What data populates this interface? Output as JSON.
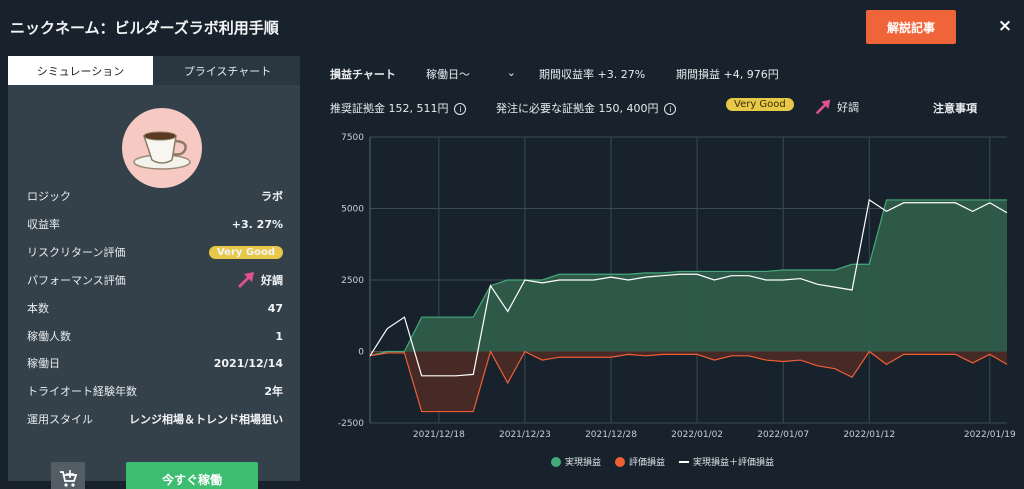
{
  "header": {
    "title": "ニックネーム：ビルダーズラボ利用手順",
    "article_button": "解説記事",
    "close_label": "×"
  },
  "left_panel": {
    "tabs": [
      "シミュレーション",
      "プライスチャート"
    ],
    "avatar_icon": "coffee-cup-icon",
    "rows": [
      {
        "label": "ロジック",
        "value": "ラボ"
      },
      {
        "label": "収益率",
        "value": "+3. 27%"
      },
      {
        "label": "リスクリターン評価",
        "value": "Very Good"
      },
      {
        "label": "パフォーマンス評価",
        "value": "好調"
      },
      {
        "label": "本数",
        "value": "47"
      },
      {
        "label": "稼働人数",
        "value": "1"
      },
      {
        "label": "稼働日",
        "value": "2021/12/14"
      },
      {
        "label": "トライオート経験年数",
        "value": "2年"
      },
      {
        "label": "運用スタイル",
        "value": "レンジ相場＆トレンド相場狙い"
      }
    ],
    "start_button": "今すぐ稼働",
    "cart_icon": "cart-add-icon"
  },
  "chart_header": {
    "chart_label": "損益チャート",
    "period_select": "稼働日～",
    "period_return": "期間収益率 +3. 27%",
    "period_pnl": "期間損益 +4, 976円",
    "recommended_margin": "推奨証拠金 152, 511円",
    "required_margin": "発注に必要な証拠金 150, 400円",
    "rating": "Very Good",
    "performance": "好調",
    "notes": "注意事項"
  },
  "colors": {
    "realized": "#45a879",
    "unrealized": "#ee5f36",
    "total": "#ffffff",
    "accent_orange": "#f0643a",
    "green_button": "#3dbd6f",
    "badge_yellow": "#e7c848"
  },
  "chart_data": {
    "type": "area",
    "x": [
      "2021/12/14",
      "2021/12/15",
      "2021/12/16",
      "2021/12/17",
      "2021/12/18",
      "2021/12/19",
      "2021/12/20",
      "2021/12/21",
      "2021/12/22",
      "2021/12/23",
      "2021/12/24",
      "2021/12/25",
      "2021/12/26",
      "2021/12/27",
      "2021/12/28",
      "2021/12/29",
      "2021/12/30",
      "2021/12/31",
      "2022/01/01",
      "2022/01/02",
      "2022/01/03",
      "2022/01/04",
      "2022/01/05",
      "2022/01/06",
      "2022/01/07",
      "2022/01/08",
      "2022/01/09",
      "2022/01/10",
      "2022/01/11",
      "2022/01/12",
      "2022/01/13",
      "2022/01/14",
      "2022/01/15",
      "2022/01/16",
      "2022/01/17",
      "2022/01/18",
      "2022/01/19",
      "2022/01/20"
    ],
    "xticks": [
      "2021/12/18",
      "2021/12/23",
      "2021/12/28",
      "2022/01/02",
      "2022/01/07",
      "2022/01/12",
      "2022/01/19"
    ],
    "yticks": [
      7500,
      5000,
      2500,
      0,
      -2500
    ],
    "ylim": [
      -2500,
      7500
    ],
    "series": [
      {
        "name": "実現損益",
        "values": [
          -150,
          0,
          0,
          1200,
          1200,
          1200,
          1200,
          2300,
          2500,
          2500,
          2500,
          2700,
          2700,
          2700,
          2700,
          2700,
          2750,
          2750,
          2800,
          2800,
          2800,
          2800,
          2800,
          2800,
          2850,
          2850,
          2850,
          2850,
          3050,
          3050,
          5300,
          5300,
          5300,
          5300,
          5300,
          5300,
          5300,
          5300
        ]
      },
      {
        "name": "評価損益",
        "values": [
          -150,
          -50,
          -50,
          -2100,
          -2100,
          -2100,
          -2100,
          0,
          -1100,
          0,
          -300,
          -200,
          -200,
          -200,
          -200,
          -100,
          -150,
          -100,
          -100,
          -100,
          -300,
          -150,
          -150,
          -300,
          -350,
          -300,
          -500,
          -600,
          -900,
          0,
          -450,
          -100,
          -100,
          -100,
          -100,
          -400,
          -100,
          -450
        ]
      },
      {
        "name": "実現損益＋評価損益",
        "values": [
          -150,
          800,
          1200,
          -850,
          -850,
          -850,
          -800,
          2300,
          1400,
          2500,
          2400,
          2500,
          2500,
          2500,
          2600,
          2500,
          2600,
          2650,
          2700,
          2700,
          2500,
          2650,
          2650,
          2500,
          2500,
          2550,
          2350,
          2250,
          2150,
          5300,
          4900,
          5200,
          5200,
          5200,
          5200,
          4900,
          5200,
          4850
        ]
      }
    ],
    "grid": true,
    "legend_position": "bottom-center"
  }
}
